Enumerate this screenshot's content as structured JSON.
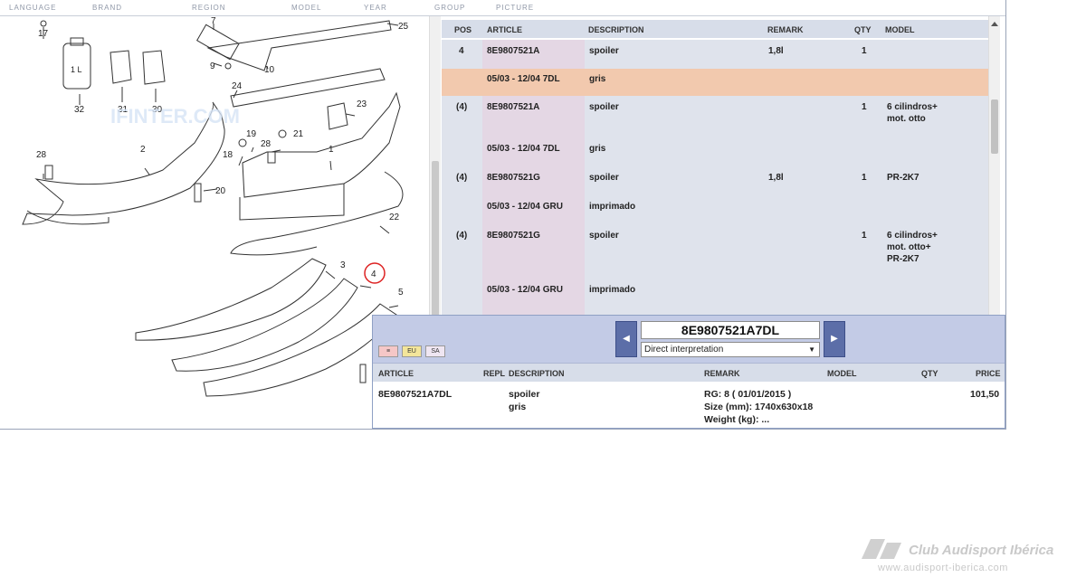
{
  "nav": [
    "LANGUAGE",
    "BRAND",
    "REGION",
    "MODEL",
    "YEAR",
    "GROUP",
    "PICTURE"
  ],
  "diagram": {
    "callouts": [
      "17",
      "7",
      "25",
      "9",
      "10",
      "32",
      "31",
      "30",
      "24",
      "23",
      "2",
      "28",
      "19",
      "21",
      "18",
      "28",
      "1",
      "20",
      "22",
      "3",
      "4",
      "5"
    ],
    "bottle_label": "1 L",
    "watermark": "IFINTER.COM"
  },
  "parts": {
    "headers": {
      "pos": "POS",
      "article": "ARTICLE",
      "description": "DESCRIPTION",
      "remark": "REMARK",
      "qty": "QTY",
      "model": "MODEL"
    },
    "rows": [
      {
        "pos": "4",
        "article": "8E9807521A",
        "description": "spoiler",
        "remark": "1,8l",
        "qty": "1",
        "model": ""
      },
      {
        "pos": "",
        "article": "05/03 - 12/04  7DL",
        "description": "gris",
        "remark": "",
        "qty": "",
        "model": "",
        "selected": true
      },
      {
        "pos": "(4)",
        "article": "8E9807521A",
        "description": "spoiler",
        "remark": "",
        "qty": "1",
        "model": "6 cilindros+\nmot. otto"
      },
      {
        "pos": "",
        "article": "05/03 - 12/04  7DL",
        "description": "gris",
        "remark": "",
        "qty": "",
        "model": ""
      },
      {
        "pos": "(4)",
        "article": "8E9807521G",
        "description": "spoiler",
        "remark": "1,8l",
        "qty": "1",
        "model": "PR-2K7"
      },
      {
        "pos": "",
        "article": "05/03 - 12/04  GRU",
        "description": "imprimado",
        "remark": "",
        "qty": "",
        "model": ""
      },
      {
        "pos": "(4)",
        "article": "8E9807521G",
        "description": "spoiler",
        "remark": "",
        "qty": "1",
        "model": "6 cilindros+\nmot. otto+\nPR-2K7"
      },
      {
        "pos": "",
        "article": "05/03 - 12/04  GRU",
        "description": "imprimado",
        "remark": "",
        "qty": "",
        "model": ""
      }
    ]
  },
  "detail": {
    "article_value": "8E9807521A7DL",
    "interpretation": "Direct interpretation",
    "flags": [
      "≡",
      "EU",
      "SA"
    ],
    "headers": {
      "article": "ARTICLE",
      "repl": "REPL",
      "description": "DESCRIPTION",
      "remark": "REMARK",
      "model": "MODEL",
      "qty": "QTY",
      "price": "PRICE"
    },
    "row": {
      "article": "8E9807521A7DL",
      "description_1": "spoiler",
      "description_2": "gris",
      "remark_1": "RG: 8 ( 01/01/2015 )",
      "remark_2": "Size (mm): 1740x630x18",
      "remark_3": "Weight (kg): ...",
      "price": "101,50"
    }
  },
  "watermark": {
    "title": "Club Audisport Ibérica",
    "url": "www.audisport-iberica.com"
  }
}
